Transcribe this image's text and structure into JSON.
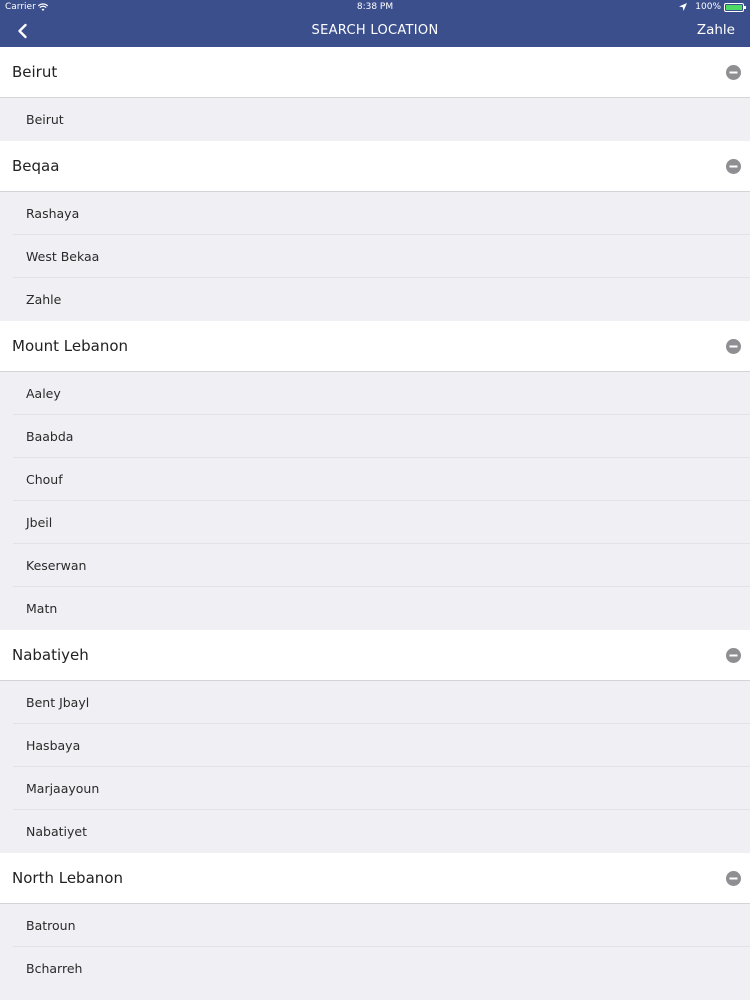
{
  "status_bar": {
    "carrier": "Carrier",
    "time": "8:38 PM",
    "battery": "100%",
    "battery_level": 1.0,
    "battery_color": "#4cd964"
  },
  "nav_bar": {
    "title": "SEARCH LOCATION",
    "right_label": "Zahle",
    "back_icon": "chevron-left-icon",
    "bar_color": "#3b4f8c"
  },
  "groups": [
    {
      "name": "Beirut",
      "items": [
        "Beirut"
      ]
    },
    {
      "name": "Beqaa",
      "items": [
        "Rashaya",
        "West Bekaa",
        "Zahle"
      ]
    },
    {
      "name": "Mount Lebanon",
      "items": [
        "Aaley",
        "Baabda",
        "Chouf",
        "Jbeil",
        "Keserwan",
        "Matn"
      ]
    },
    {
      "name": "Nabatiyeh",
      "items": [
        "Bent Jbayl",
        "Hasbaya",
        "Marjaayoun",
        "Nabatiyet"
      ]
    },
    {
      "name": "North Lebanon",
      "items": [
        "Batroun",
        "Bcharreh"
      ]
    }
  ]
}
